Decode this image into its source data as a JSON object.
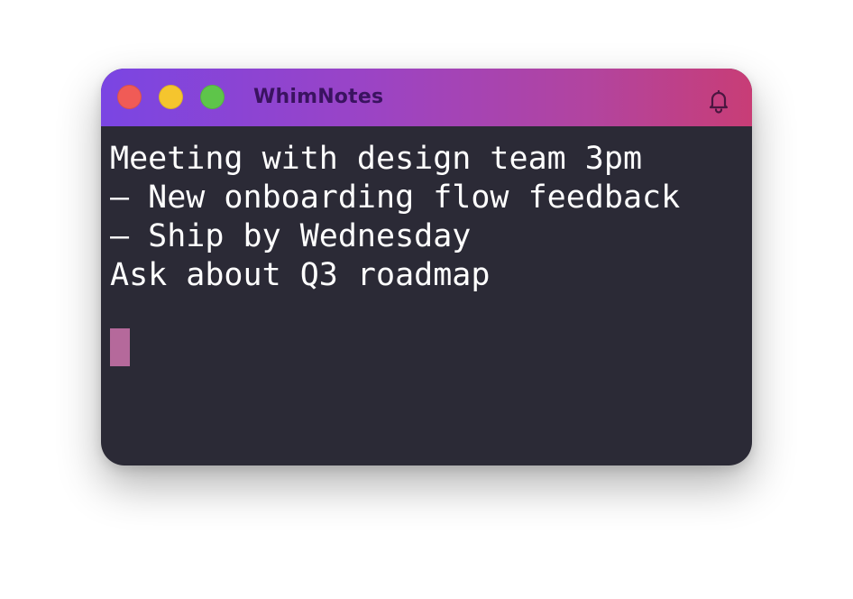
{
  "window": {
    "title": "WhimNotes",
    "controls": [
      "close",
      "minimize",
      "zoom"
    ]
  },
  "header": {
    "notification_icon": "bell-icon"
  },
  "editor": {
    "lines": [
      "Meeting with design team 3pm",
      "– New onboarding flow feedback",
      "– Ship by Wednesday",
      "Ask about Q3 roadmap",
      ""
    ]
  },
  "colors": {
    "gradient_start": "#7a45e3",
    "gradient_end": "#c83d76",
    "editor_background": "#2b2a36",
    "text": "#ffffff",
    "cursor": "#b5699b",
    "close": "#f05b56",
    "minimize": "#f5c52e",
    "zoom": "#5ec54a"
  }
}
